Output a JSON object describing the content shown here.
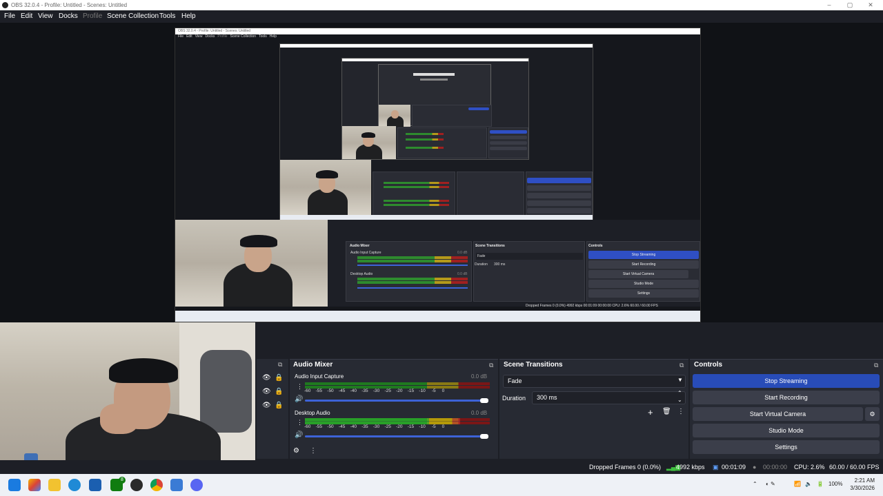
{
  "window": {
    "title": "OBS 32.0.4 - Profile: Untitled - Scenes: Untitled",
    "minimize": "–",
    "maximize": "▢",
    "close": "✕"
  },
  "menu": {
    "items": [
      {
        "label": "File",
        "enabled": true
      },
      {
        "label": "Edit",
        "enabled": true
      },
      {
        "label": "View",
        "enabled": true
      },
      {
        "label": "Docks",
        "enabled": true
      },
      {
        "label": "Profile",
        "enabled": false
      },
      {
        "label": "Scene Collection",
        "enabled": true
      },
      {
        "label": "Tools",
        "enabled": true
      },
      {
        "label": "Help",
        "enabled": true
      }
    ]
  },
  "nested_preview": {
    "title": "OBS 32.0.4 - Profile: Untitled - Scenes: Untitled",
    "menu": [
      "File",
      "Edit",
      "View",
      "Docks",
      "Profile",
      "Scene Collection",
      "Tools",
      "Help"
    ],
    "audio_mixer_title": "Audio Mixer",
    "scene_transitions_title": "Scene Transitions",
    "controls_title": "Controls",
    "audio_input": "Audio Input Capture",
    "desktop_audio": "Desktop Audio",
    "db_value": "0.0 dB",
    "transition": "Fade",
    "duration_label": "Duration",
    "duration_value": "300 ms",
    "buttons": [
      "Stop Streaming",
      "Start Recording",
      "Start Virtual Camera",
      "Studio Mode",
      "Settings"
    ],
    "status": "Dropped Frames 0 (0.0%)   4992 kbps   00:01:09   00:00:00   CPU: 2.6%   60.00 / 60.00 FPS"
  },
  "audio_mixer": {
    "title": "Audio Mixer",
    "channels": [
      {
        "name": "Audio Input Capture",
        "db": "0.0 dB"
      },
      {
        "name": "Desktop Audio",
        "db": "0.0 dB"
      }
    ],
    "scale": [
      "-60",
      "-55",
      "-50",
      "-45",
      "-40",
      "-35",
      "-30",
      "-25",
      "-20",
      "-15",
      "-10",
      "-5",
      "0"
    ]
  },
  "scene_transitions": {
    "title": "Scene Transitions",
    "transition": "Fade",
    "duration_label": "Duration",
    "duration_value": "300 ms"
  },
  "controls": {
    "title": "Controls",
    "stop_streaming": "Stop Streaming",
    "start_recording": "Start Recording",
    "start_virtual_camera": "Start Virtual Camera",
    "studio_mode": "Studio Mode",
    "settings": "Settings"
  },
  "status_bar": {
    "dropped_frames": "Dropped Frames 0 (0.0%)",
    "bitrate": "4992 kbps",
    "stream_time": "00:01:09",
    "record_time": "00:00:00",
    "cpu": "CPU: 2.6%",
    "fps": "60.00 / 60.00 FPS"
  },
  "taskbar": {
    "battery": "100%",
    "time": "2:21 AM",
    "date": "3/30/2026",
    "xbox_badge": "8"
  },
  "colors": {
    "accent": "#284cb8",
    "bg": "#1d1f26",
    "panel": "#272a33"
  }
}
